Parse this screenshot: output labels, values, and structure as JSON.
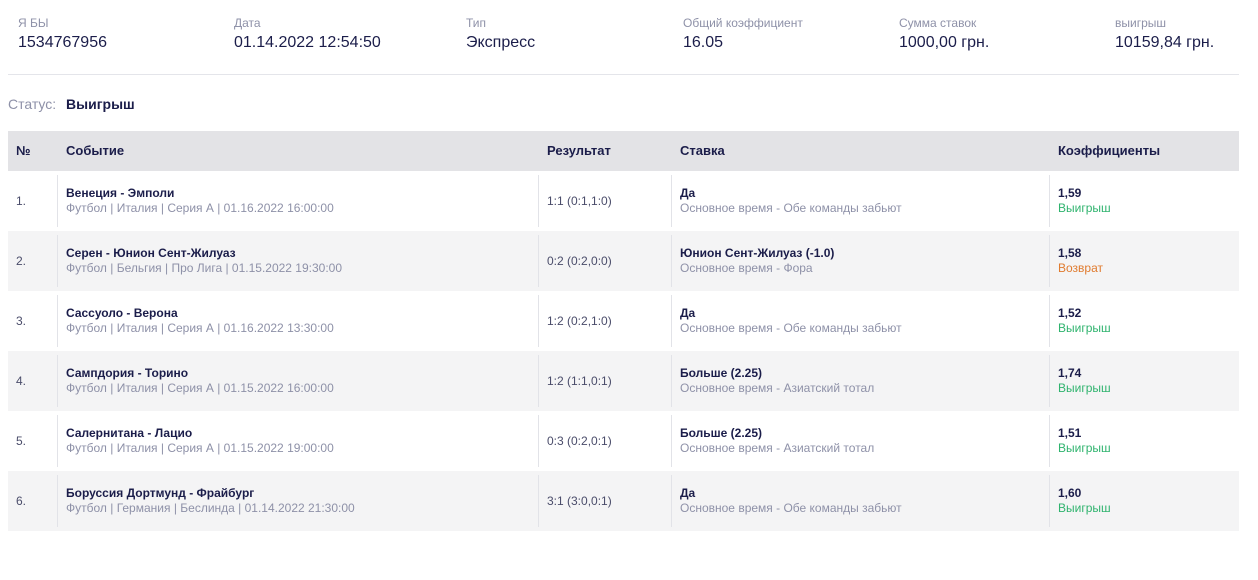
{
  "summary": {
    "id": {
      "label": "Я БЫ",
      "value": "1534767956"
    },
    "date": {
      "label": "Дата",
      "value": "01.14.2022 12:54:50"
    },
    "type": {
      "label": "Тип",
      "value": "Экспресс"
    },
    "total_odds": {
      "label": "Общий коэффициент",
      "value": "16.05"
    },
    "stake": {
      "label": "Сумма ставок",
      "value": "1000,00 грн."
    },
    "winnings": {
      "label": "выигрыш",
      "value": "10159,84 грн."
    }
  },
  "status": {
    "label": "Статус:",
    "value": "Выигрыш"
  },
  "table": {
    "headers": {
      "num": "№",
      "event": "Событие",
      "result": "Результат",
      "bet": "Ставка",
      "odds": "Коэффициенты"
    },
    "rows": [
      {
        "num": "1.",
        "event": "Венеция - Эмполи",
        "details": "Футбол | Италия | Серия А | 01.16.2022 16:00:00",
        "result": "1:1 (0:1,1:0)",
        "bet": "Да",
        "market": "Основное время - Обе команды забьют",
        "odds": "1,59",
        "outcome": "Выигрыш",
        "outcome_color": "green"
      },
      {
        "num": "2.",
        "event": "Серен - Юнион Сент-Жилуаз",
        "details": "Футбол | Бельгия | Про Лига | 01.15.2022 19:30:00",
        "result": "0:2 (0:2,0:0)",
        "bet": "Юнион Сент-Жилуаз (-1.0)",
        "market": "Основное время - Фора",
        "odds": "1,58",
        "outcome": "Возврат",
        "outcome_color": "orange"
      },
      {
        "num": "3.",
        "event": "Сассуоло - Верона",
        "details": "Футбол | Италия | Серия А | 01.16.2022 13:30:00",
        "result": "1:2 (0:2,1:0)",
        "bet": "Да",
        "market": "Основное время - Обе команды забьют",
        "odds": "1,52",
        "outcome": "Выигрыш",
        "outcome_color": "green"
      },
      {
        "num": "4.",
        "event": "Сампдория - Торино",
        "details": "Футбол | Италия | Серия А | 01.15.2022 16:00:00",
        "result": "1:2 (1:1,0:1)",
        "bet": "Больше (2.25)",
        "market": "Основное время - Азиатский тотал",
        "odds": "1,74",
        "outcome": "Выигрыш",
        "outcome_color": "green"
      },
      {
        "num": "5.",
        "event": "Салернитана - Лацио",
        "details": "Футбол | Италия | Серия А | 01.15.2022 19:00:00",
        "result": "0:3 (0:2,0:1)",
        "bet": "Больше (2.25)",
        "market": "Основное время - Азиатский тотал",
        "odds": "1,51",
        "outcome": "Выигрыш",
        "outcome_color": "green"
      },
      {
        "num": "6.",
        "event": "Боруссия Дортмунд - Фрайбург",
        "details": "Футбол | Германия | Беслинда | 01.14.2022 21:30:00",
        "result": "3:1 (3:0,0:1)",
        "bet": "Да",
        "market": "Основное время - Обе команды забьют",
        "odds": "1,60",
        "outcome": "Выигрыш",
        "outcome_color": "green"
      }
    ]
  },
  "colors": {
    "text_primary": "#1b1d4a",
    "text_muted": "#8e91a8",
    "win": "#2fb36e",
    "refund": "#e07b2f",
    "header_bg": "#e3e3e6",
    "row_alt_bg": "#f4f4f5"
  }
}
